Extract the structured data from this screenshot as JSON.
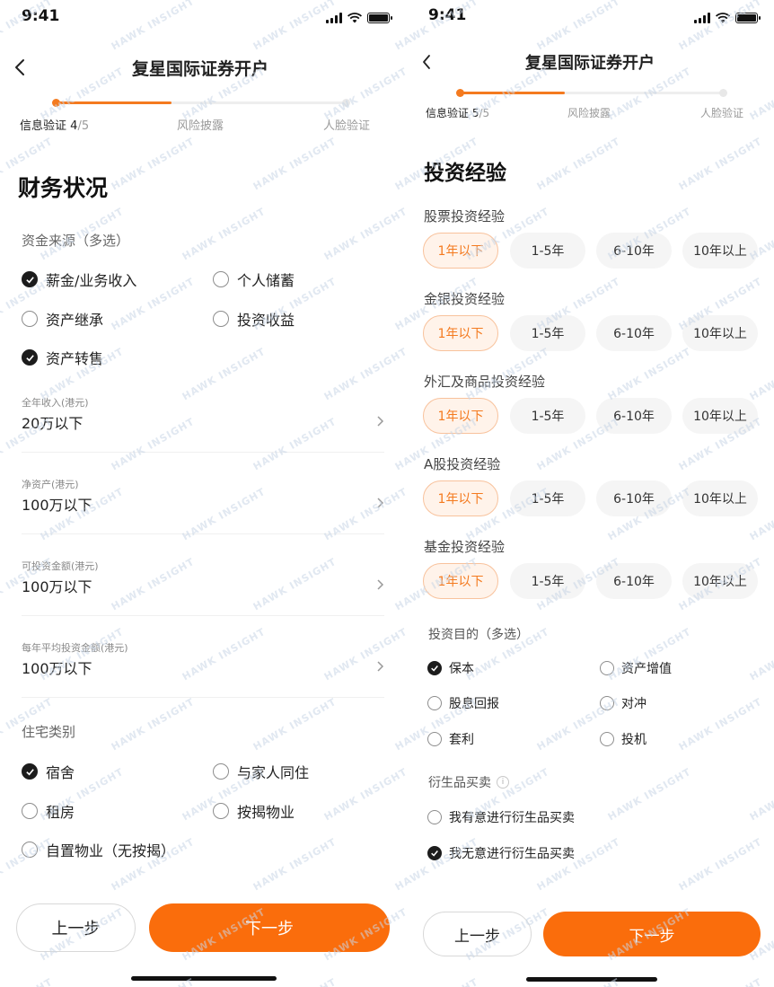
{
  "status_bar": {
    "time": "9:41"
  },
  "watermark": {
    "text": "HAWK INSIGHT"
  },
  "brand": {
    "accent": "#f47a1f",
    "button_orange": "#fa6d0c",
    "chip_bg": "#fff3ea"
  },
  "left": {
    "title": "复星国际证券开户",
    "progress": {
      "fraction": 0.4
    },
    "steps": {
      "current_label": "信息验证",
      "current_num": "4",
      "total": "/5",
      "step2": "风险披露",
      "step3": "人脸验证"
    },
    "section_title": "财务状况",
    "fund_source": {
      "label": "资金来源（多选）",
      "options": [
        {
          "label": "薪金/业务收入",
          "checked": true
        },
        {
          "label": "个人储蓄",
          "checked": false
        },
        {
          "label": "资产继承",
          "checked": false
        },
        {
          "label": "投资收益",
          "checked": false
        },
        {
          "label": "资产转售",
          "checked": true
        }
      ]
    },
    "fields": [
      {
        "label": "全年收入(港元)",
        "value": "20万以下"
      },
      {
        "label": "净资产(港元)",
        "value": "100万以下"
      },
      {
        "label": "可投资金额(港元)",
        "value": "100万以下"
      },
      {
        "label": "每年平均投资金额(港元)",
        "value": "100万以下"
      }
    ],
    "housing": {
      "label": "住宅类别",
      "options": [
        {
          "label": "宿舍",
          "checked": true
        },
        {
          "label": "与家人同住",
          "checked": false
        },
        {
          "label": "租房",
          "checked": false
        },
        {
          "label": "按揭物业",
          "checked": false
        },
        {
          "label": "自置物业（无按揭）",
          "checked": false
        }
      ]
    },
    "buttons": {
      "prev": "上一步",
      "next": "下一步"
    }
  },
  "right": {
    "title": "复星国际证券开户",
    "progress": {
      "fraction": 0.4
    },
    "steps": {
      "current_label": "信息验证",
      "current_num": "5",
      "total": "/5",
      "step2": "风险披露",
      "step3": "人脸验证"
    },
    "section_title": "投资经验",
    "experience_groups": [
      {
        "label": "股票投资经验",
        "options": [
          "1年以下",
          "1-5年",
          "6-10年",
          "10年以上"
        ],
        "selected": 0
      },
      {
        "label": "金银投资经验",
        "options": [
          "1年以下",
          "1-5年",
          "6-10年",
          "10年以上"
        ],
        "selected": 0
      },
      {
        "label": "外汇及商品投资经验",
        "options": [
          "1年以下",
          "1-5年",
          "6-10年",
          "10年以上"
        ],
        "selected": 0
      },
      {
        "label": "A股投资经验",
        "options": [
          "1年以下",
          "1-5年",
          "6-10年",
          "10年以上"
        ],
        "selected": 0
      },
      {
        "label": "基金投资经验",
        "options": [
          "1年以下",
          "1-5年",
          "6-10年",
          "10年以上"
        ],
        "selected": 0
      }
    ],
    "purpose": {
      "label": "投资目的（多选）",
      "options": [
        {
          "label": "保本",
          "checked": true
        },
        {
          "label": "资产增值",
          "checked": false
        },
        {
          "label": "股息回报",
          "checked": false
        },
        {
          "label": "对冲",
          "checked": false
        },
        {
          "label": "套利",
          "checked": false
        },
        {
          "label": "投机",
          "checked": false
        }
      ]
    },
    "derivatives": {
      "label": "衍生品买卖",
      "info_icon": "info-icon",
      "options": [
        {
          "label": "我有意进行衍生品买卖",
          "checked": false
        },
        {
          "label": "我无意进行衍生品买卖",
          "checked": true
        }
      ]
    },
    "buttons": {
      "prev": "上一步",
      "next": "下一步"
    }
  }
}
